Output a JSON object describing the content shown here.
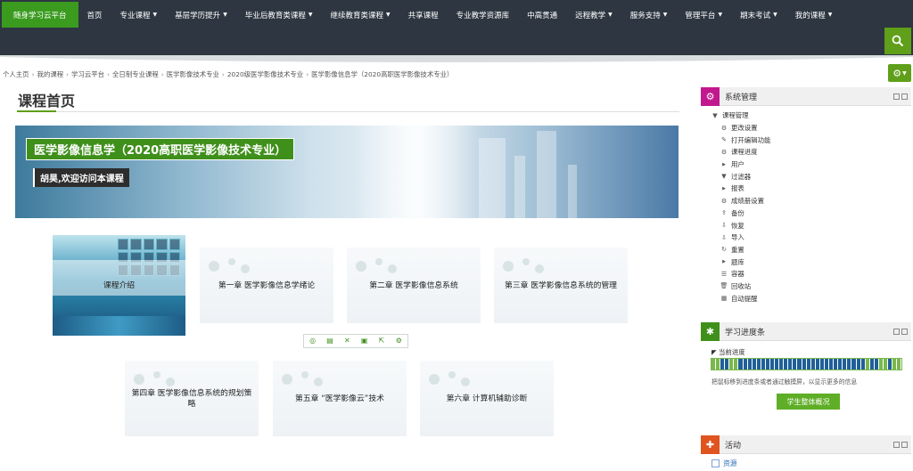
{
  "nav": {
    "brand": "随身学习云平台",
    "items": [
      {
        "label": "首页",
        "caret": false
      },
      {
        "label": "专业课程",
        "caret": true
      },
      {
        "label": "基层学历提升",
        "caret": true
      },
      {
        "label": "毕业后教育类课程",
        "caret": true
      },
      {
        "label": "继续教育类课程",
        "caret": true
      },
      {
        "label": "共享课程",
        "caret": false
      },
      {
        "label": "专业教学资源库",
        "caret": false
      },
      {
        "label": "中高贯通",
        "caret": false
      },
      {
        "label": "远程教学",
        "caret": true
      },
      {
        "label": "服务支持",
        "caret": true
      },
      {
        "label": "管理平台",
        "caret": true
      },
      {
        "label": "期末考试",
        "caret": true
      },
      {
        "label": "我的课程",
        "caret": true
      }
    ]
  },
  "breadcrumb": [
    "个人主页",
    "我的课程",
    "学习云平台",
    "全日制专业课程",
    "医学影像技术专业",
    "2020级医学影像技术专业",
    "医学影像信息学（2020高职医学影像技术专业）"
  ],
  "page_title": "课程首页",
  "banner": {
    "course_name": "医学影像信息学（2020高职医学影像技术专业）",
    "welcome": "胡昊,欢迎访问本课程"
  },
  "tiles": [
    "课程介绍",
    "第一章 医学影像信息学绪论",
    "第二章 医学影像信息系统",
    "第三章 医学影像信息系统的管理",
    "第四章 医学影像信息系统的规划策略",
    "第五章 “医学影像云”技术",
    "第六章 计算机辅助诊断"
  ],
  "admin_block": {
    "title": "系统管理",
    "root": "课程管理",
    "items": [
      {
        "label": "更改设置",
        "icon": "gear-icon"
      },
      {
        "label": "打开编辑功能",
        "icon": "pencil-icon"
      },
      {
        "label": "课程进度",
        "icon": "gear-icon"
      },
      {
        "label": "用户",
        "icon": "triangle-right-icon"
      },
      {
        "label": "过滤器",
        "icon": "filter-icon"
      },
      {
        "label": "报表",
        "icon": "triangle-right-icon"
      },
      {
        "label": "成绩册设置",
        "icon": "gear-icon"
      },
      {
        "label": "备份",
        "icon": "upload-icon"
      },
      {
        "label": "恢复",
        "icon": "download-icon"
      },
      {
        "label": "导入",
        "icon": "download-icon"
      },
      {
        "label": "重置",
        "icon": "reset-icon"
      },
      {
        "label": "题库",
        "icon": "triangle-right-icon"
      },
      {
        "label": "容器",
        "icon": "stack-icon"
      },
      {
        "label": "回收站",
        "icon": "trash-icon"
      },
      {
        "label": "自动提醒",
        "icon": "calendar-icon"
      }
    ]
  },
  "progress_block": {
    "title": "学习进度条",
    "current_label": "当前进度",
    "hint": "把鼠标移到进度条或者通过触摸屏，以显示更多的信息",
    "button": "学生整体概况",
    "colors": {
      "done": "#7ab84e",
      "todo": "#1f5f99"
    }
  },
  "activity_block": {
    "title": "活动",
    "item": "资源"
  },
  "colors": {
    "accent": "#5f9f1a",
    "nav_bg": "#2d3641"
  }
}
